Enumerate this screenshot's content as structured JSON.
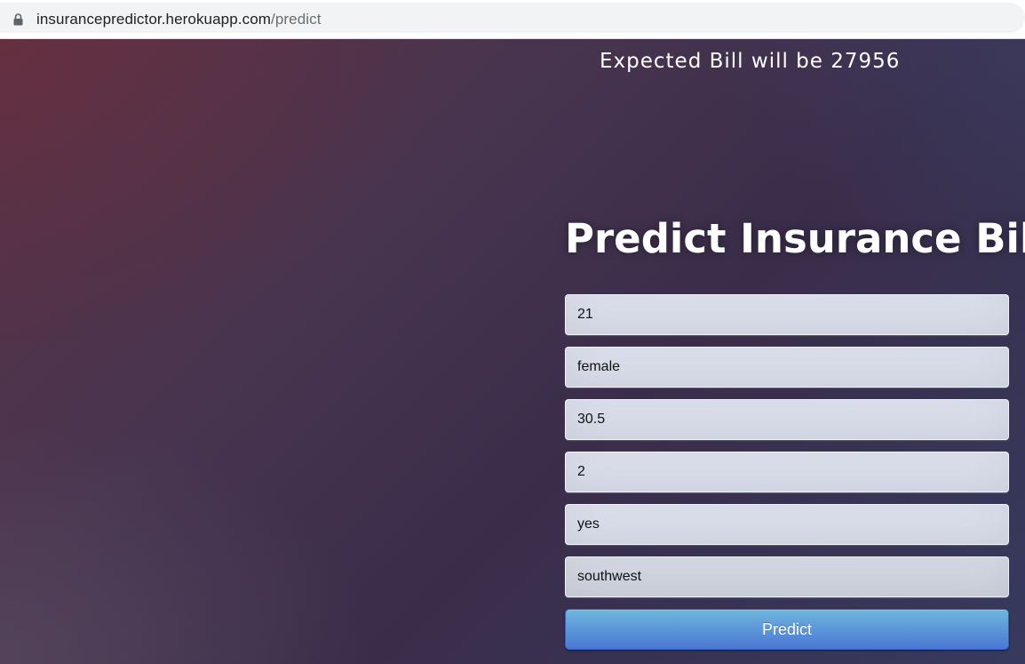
{
  "browser": {
    "url_host": "insurancepredictor.herokuapp.com",
    "url_path": "/predict",
    "lock_icon": "lock-icon"
  },
  "result": {
    "text": "Expected Bill will be 27956"
  },
  "form": {
    "title": "Predict Insurance Bill",
    "fields": [
      {
        "value": "21"
      },
      {
        "value": "female"
      },
      {
        "value": "30.5"
      },
      {
        "value": "2"
      },
      {
        "value": "yes"
      },
      {
        "value": "southwest"
      }
    ],
    "submit_label": "Predict"
  },
  "colors": {
    "button_top": "#6eb6de",
    "button_bottom": "#4a77d4",
    "background_dark": "#3a2d4a"
  }
}
